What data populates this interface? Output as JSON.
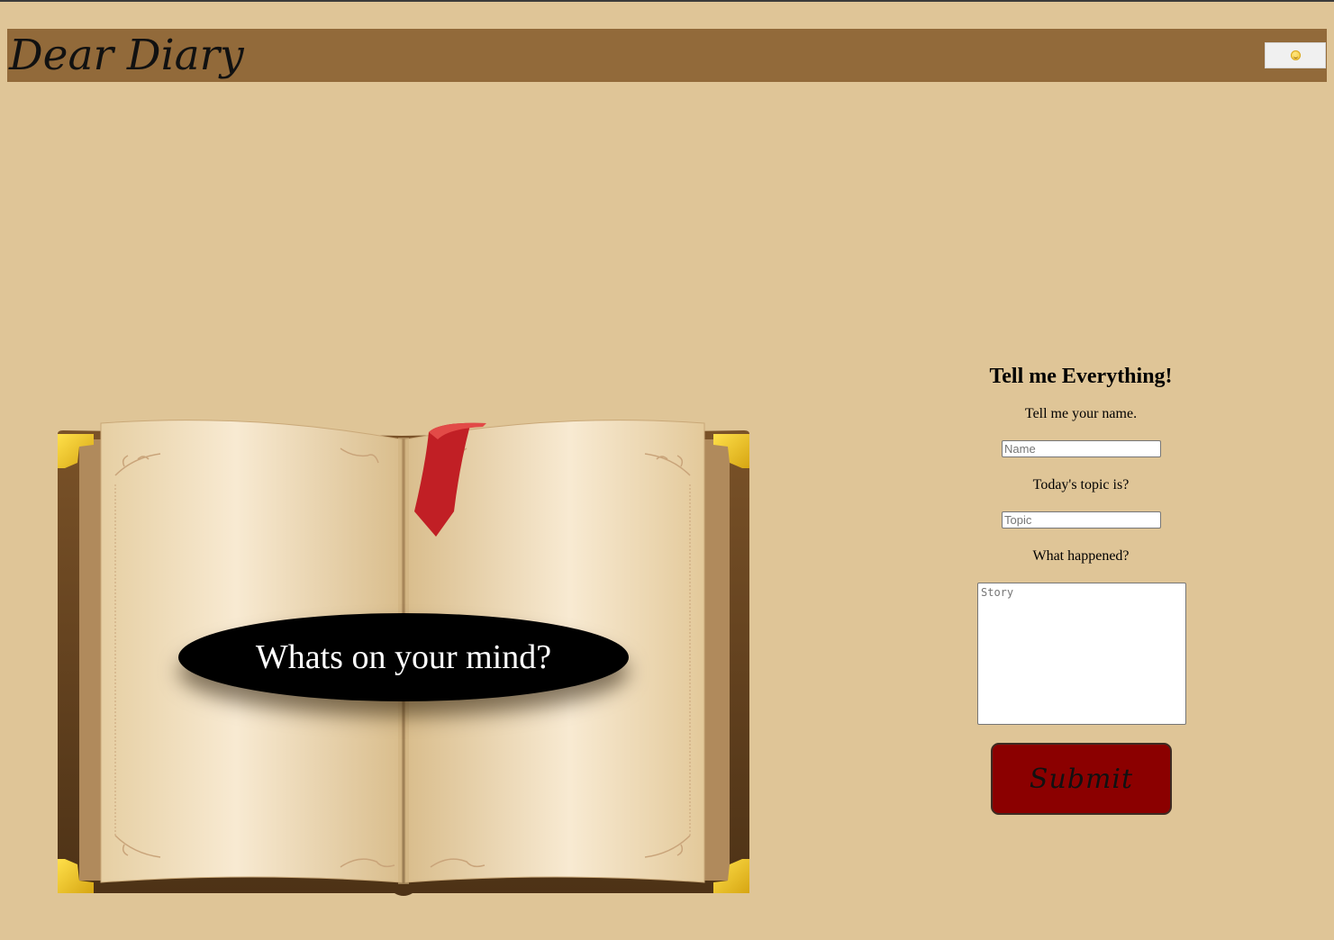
{
  "header": {
    "title": "Dear Diary",
    "mood_button_icon": "smiley-face-icon"
  },
  "hero": {
    "prompt": "Whats on your mind?"
  },
  "form": {
    "title": "Tell me Everything!",
    "name_label": "Tell me your name.",
    "name_placeholder": "Name",
    "topic_label": "Today's topic is?",
    "topic_placeholder": "Topic",
    "story_label": "What happened?",
    "story_placeholder": "Story",
    "submit_label": "Submit"
  },
  "colors": {
    "background": "#dfc597",
    "header": "#926a3a",
    "submit": "#8b0000",
    "bookmark": "#c11f25",
    "book_cover": "#6b4420",
    "corner_gold": "#f2c62c"
  }
}
